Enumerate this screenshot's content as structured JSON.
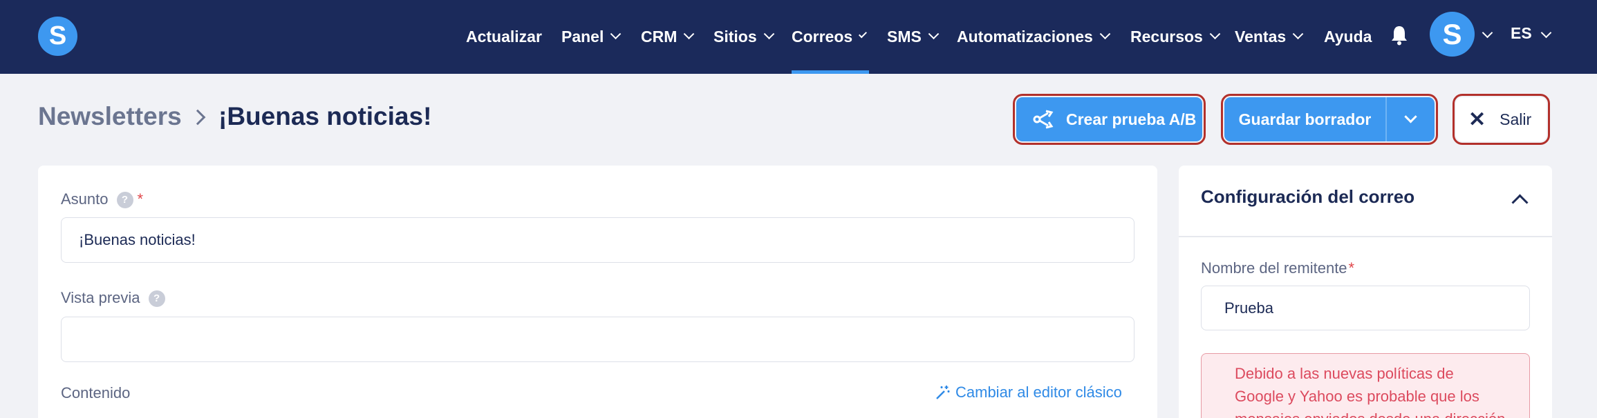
{
  "brand": {
    "logo_letter": "S"
  },
  "nav": {
    "items": [
      {
        "label": "Actualizar",
        "dropdown": false,
        "active": false
      },
      {
        "label": "Panel",
        "dropdown": true,
        "active": false
      },
      {
        "label": "CRM",
        "dropdown": true,
        "active": false
      },
      {
        "label": "Sitios",
        "dropdown": true,
        "active": false
      },
      {
        "label": "Correos",
        "dropdown": true,
        "active": true
      },
      {
        "label": "SMS",
        "dropdown": true,
        "active": false
      },
      {
        "label": "Automatizaciones",
        "dropdown": true,
        "active": false
      },
      {
        "label": "Recursos",
        "dropdown": true,
        "active": false
      },
      {
        "label": "Ventas",
        "dropdown": true,
        "active": false
      },
      {
        "label": "Ayuda",
        "dropdown": false,
        "active": false
      }
    ],
    "bell_icon": "bell-icon",
    "avatar_letter": "S",
    "language": "ES"
  },
  "breadcrumb": {
    "root": "Newsletters",
    "current": "¡Buenas noticias!"
  },
  "actions": {
    "ab_test_label": "Crear prueba A/B",
    "save_draft_label": "Guardar borrador",
    "exit_label": "Salir",
    "exit_icon": "✕"
  },
  "form": {
    "subject_label": "Asunto",
    "subject_value": "¡Buenas noticias!",
    "preview_label": "Vista previa",
    "preview_value": "",
    "content_label": "Contenido",
    "switch_editor_label": "Cambiar al editor clásico",
    "help_glyph": "?",
    "required_mark": "*"
  },
  "config": {
    "title": "Configuración del correo",
    "sender_label": "Nombre del remitente",
    "sender_value": "Prueba",
    "alert_lines": [
      "Debido a las nuevas políticas de",
      "Google y Yahoo es probable que los",
      "mensajes enviados desde una dirección"
    ]
  },
  "colors": {
    "navbar": "#1b2a5b",
    "accent": "#3d98f0",
    "highlight_outline": "#b2302b",
    "alert_text": "#dc4a5e"
  }
}
